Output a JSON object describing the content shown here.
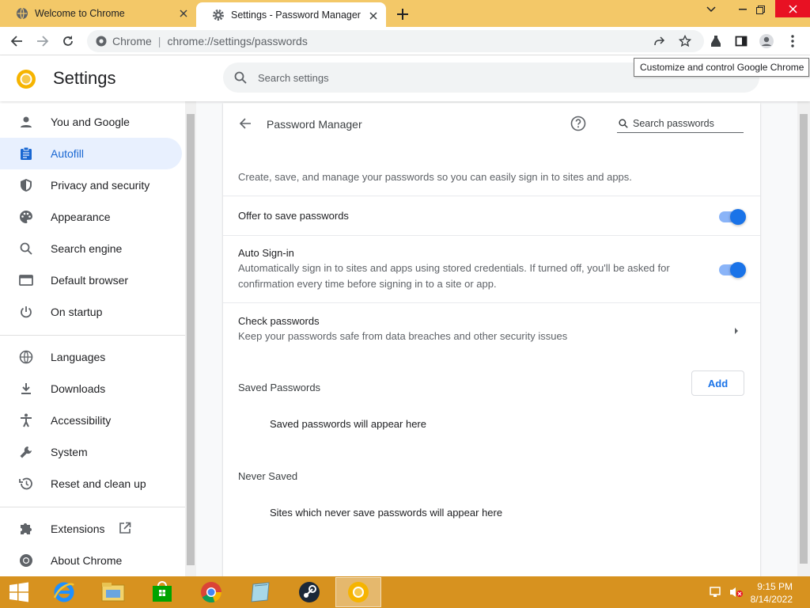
{
  "colors": {
    "titlebar": "#f3c868",
    "accent": "#1a73e8",
    "taskbar": "#d7921f",
    "active_nav_bg": "#e8f0fe"
  },
  "tabs": [
    {
      "title": "Welcome to Chrome",
      "icon": "globe-icon"
    },
    {
      "title": "Settings - Password Manager",
      "icon": "gear-icon"
    }
  ],
  "omnibox": {
    "origin": "Chrome",
    "separator": "|",
    "url": "chrome://settings/passwords"
  },
  "tooltip": "Customize and control Google Chrome",
  "header": {
    "title": "Settings",
    "search_placeholder": "Search settings"
  },
  "sidebar": {
    "items": [
      {
        "label": "You and Google",
        "icon": "person-icon"
      },
      {
        "label": "Autofill",
        "icon": "clipboard-icon",
        "active": true
      },
      {
        "label": "Privacy and security",
        "icon": "shield-icon"
      },
      {
        "label": "Appearance",
        "icon": "palette-icon"
      },
      {
        "label": "Search engine",
        "icon": "search-icon"
      },
      {
        "label": "Default browser",
        "icon": "browser-icon"
      },
      {
        "label": "On startup",
        "icon": "power-icon"
      },
      {
        "label": "Languages",
        "icon": "globe-icon"
      },
      {
        "label": "Downloads",
        "icon": "download-icon"
      },
      {
        "label": "Accessibility",
        "icon": "accessibility-icon"
      },
      {
        "label": "System",
        "icon": "wrench-icon"
      },
      {
        "label": "Reset and clean up",
        "icon": "history-icon"
      },
      {
        "label": "Extensions",
        "icon": "puzzle-icon"
      },
      {
        "label": "About Chrome",
        "icon": "chrome-icon"
      }
    ]
  },
  "password_manager": {
    "title": "Password Manager",
    "search_placeholder": "Search passwords",
    "description": "Create, save, and manage your passwords so you can easily sign in to sites and apps.",
    "offer_to_save": {
      "label": "Offer to save passwords",
      "enabled": true
    },
    "auto_signin": {
      "label": "Auto Sign-in",
      "description": "Automatically sign in to sites and apps using stored credentials. If turned off, you'll be asked for confirmation every time before signing in to a site or app.",
      "enabled": true
    },
    "check_passwords": {
      "label": "Check passwords",
      "description": "Keep your passwords safe from data breaches and other security issues"
    },
    "saved": {
      "heading": "Saved Passwords",
      "add_label": "Add",
      "empty": "Saved passwords will appear here"
    },
    "never_saved": {
      "heading": "Never Saved",
      "empty": "Sites which never save passwords will appear here"
    }
  },
  "taskbar": {
    "apps": [
      "start-icon",
      "internet-explorer-icon",
      "file-explorer-icon",
      "store-icon",
      "chrome-icon",
      "app-icon",
      "steam-icon",
      "chrome-canary-icon"
    ],
    "time": "9:15 PM",
    "date": "8/14/2022"
  }
}
